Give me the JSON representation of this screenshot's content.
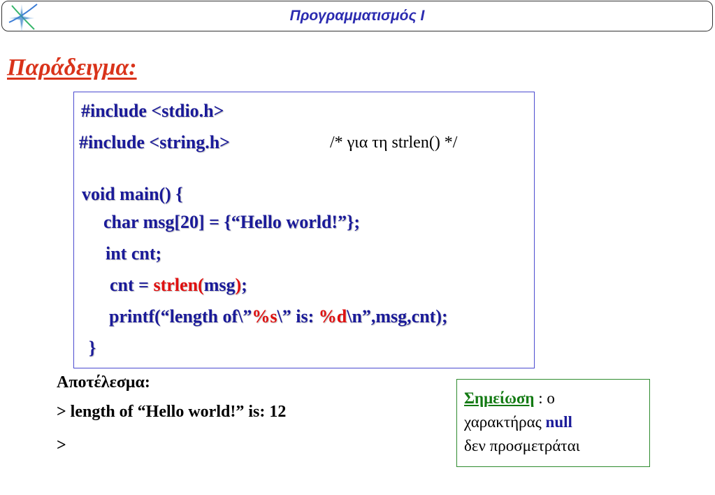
{
  "header": {
    "title": "Προγραμματισμός Ι",
    "logo_icon": "compass-star-logo-icon"
  },
  "slide": {
    "title": "Παράδειγμα:"
  },
  "code": {
    "line1": "#include <stdio.h>",
    "line2": "#include <string.h>",
    "comment": "/* για τη strlen() */",
    "line3": "void main() {",
    "line4": "char msg[20] = {“Hello world!”};",
    "line5": "int cnt;",
    "line6_a": "cnt = ",
    "line6_b": "strlen(",
    "line6_c": "msg",
    "line6_d": ")",
    "line6_e": ";",
    "line7_a": "printf(“length of\\”",
    "line7_b": "%s",
    "line7_c": "\\” is: ",
    "line7_d": "%d",
    "line7_e": "\\n”,msg,cnt);",
    "line8": "}"
  },
  "result": {
    "label": "Αποτέλεσμα:",
    "output": "> length of “Hello world!” is: 12",
    "prompt": ">"
  },
  "note": {
    "label": "Σημείωση",
    "text1": " : ο",
    "text2": "χαρακτήρας ",
    "null_word": "null",
    "text3": "δεν προσμετράται"
  },
  "colors": {
    "title_red": "#d9331a",
    "code_blue": "#1a1a99",
    "highlight_red": "#e01010",
    "note_green": "#137a13",
    "header_blue": "#2b2bb0"
  }
}
